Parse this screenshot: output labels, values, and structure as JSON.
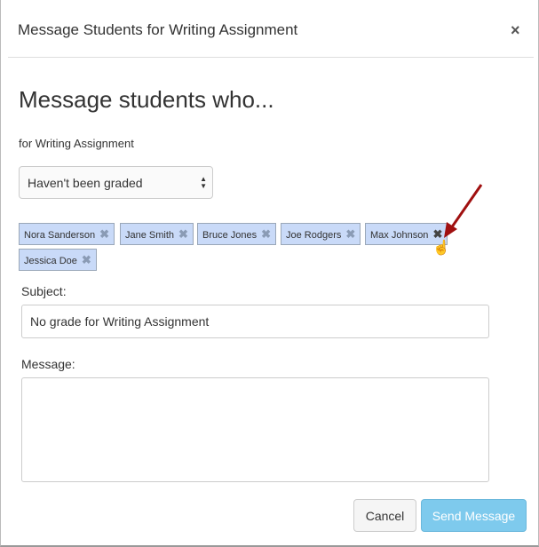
{
  "dialog": {
    "title": "Message Students for Writing Assignment",
    "close_label": "×",
    "heading": "Message students who...",
    "subheading": "for Writing Assignment",
    "filter": {
      "selected": "Haven't been graded"
    },
    "recipients": [
      "Nora Sanderson",
      "Jane Smith",
      "Bruce Jones",
      "Joe Rodgers",
      "Max Johnson",
      "Jessica Doe"
    ],
    "remove_glyph": "✖",
    "subject_label": "Subject:",
    "subject_value": "No grade for Writing Assignment",
    "message_label": "Message:",
    "message_value": "",
    "cancel_label": "Cancel",
    "send_label": "Send Message"
  },
  "colors": {
    "tag_bg": "#c9daf8",
    "send_bg": "#7ecaed",
    "annotation_arrow": "#a01010"
  }
}
